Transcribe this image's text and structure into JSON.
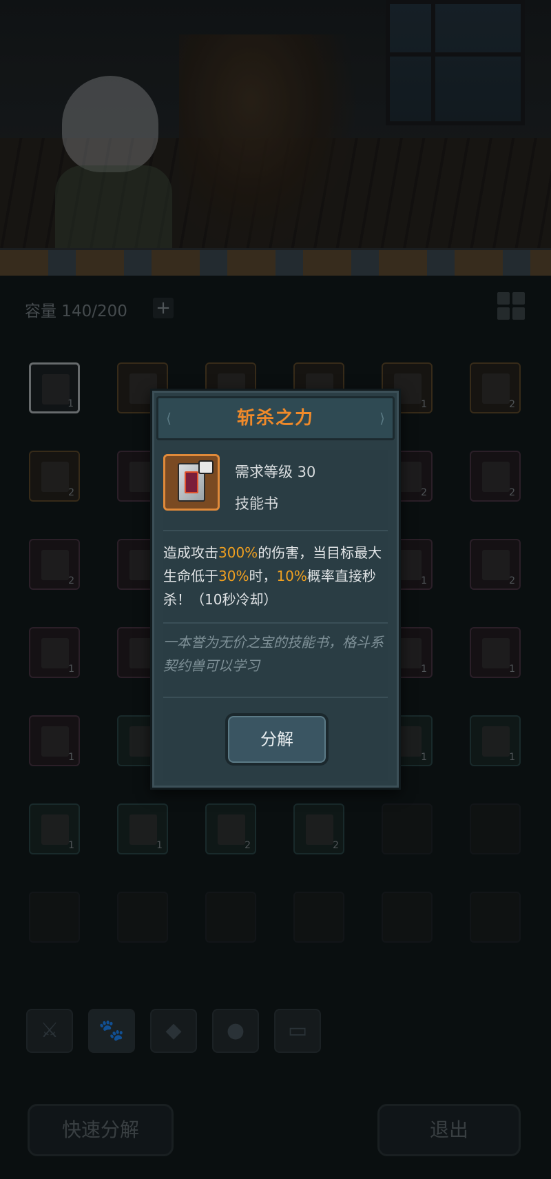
{
  "scene": {
    "description_icons": [
      "hero-character",
      "npc-character",
      "window"
    ]
  },
  "inventory": {
    "capacity_label": "容量 140/200",
    "add_icon": "+",
    "slots": [
      {
        "count": "1",
        "tone": "selected"
      },
      {
        "count": "",
        "tone": "orange"
      },
      {
        "count": "",
        "tone": "orange"
      },
      {
        "count": "",
        "tone": "orange"
      },
      {
        "count": "1",
        "tone": "orange"
      },
      {
        "count": "2",
        "tone": "orange"
      },
      {
        "count": "2",
        "tone": "orange"
      },
      {
        "count": "",
        "tone": "purple"
      },
      {
        "count": "",
        "tone": "purple"
      },
      {
        "count": "",
        "tone": "purple"
      },
      {
        "count": "2",
        "tone": "purple"
      },
      {
        "count": "2",
        "tone": "purple"
      },
      {
        "count": "2",
        "tone": "purple"
      },
      {
        "count": "",
        "tone": "purple"
      },
      {
        "count": "",
        "tone": "purple"
      },
      {
        "count": "",
        "tone": "purple"
      },
      {
        "count": "1",
        "tone": "purple"
      },
      {
        "count": "2",
        "tone": "purple"
      },
      {
        "count": "1",
        "tone": "purple"
      },
      {
        "count": "",
        "tone": "purple"
      },
      {
        "count": "",
        "tone": "purple"
      },
      {
        "count": "",
        "tone": "purple"
      },
      {
        "count": "1",
        "tone": "purple"
      },
      {
        "count": "1",
        "tone": "purple"
      },
      {
        "count": "1",
        "tone": "purple"
      },
      {
        "count": "",
        "tone": "teal"
      },
      {
        "count": "",
        "tone": "teal"
      },
      {
        "count": "",
        "tone": "teal"
      },
      {
        "count": "1",
        "tone": "teal"
      },
      {
        "count": "1",
        "tone": "teal"
      },
      {
        "count": "1",
        "tone": "teal"
      },
      {
        "count": "1",
        "tone": "teal"
      },
      {
        "count": "2",
        "tone": "teal"
      },
      {
        "count": "2",
        "tone": "teal"
      },
      {
        "count": "",
        "tone": "empty"
      },
      {
        "count": "",
        "tone": "empty"
      }
    ],
    "filter_tabs": [
      "weapon-icon",
      "paw-icon",
      "gem-icon",
      "stone-icon",
      "chest-icon"
    ],
    "quick_decompose_label": "快速分解",
    "exit_label": "退出"
  },
  "popup": {
    "title": "斩杀之力",
    "required_level": "需求等级 30",
    "item_type": "技能书",
    "description": {
      "p1": "造成攻击",
      "v1": "300%",
      "p2": "的伤害，当目标最大生命低于",
      "v2": "30%",
      "p3": "时，",
      "v3": "10%",
      "p4": "概率直接秒杀！（10秒冷却）"
    },
    "flavor": "一本誉为无价之宝的技能书，格斗系契约兽可以学习",
    "decompose_label": "分解"
  },
  "colors": {
    "title": "#f08a2a",
    "highlight": "#f0a020",
    "popup_bg": "#2b3e45"
  }
}
